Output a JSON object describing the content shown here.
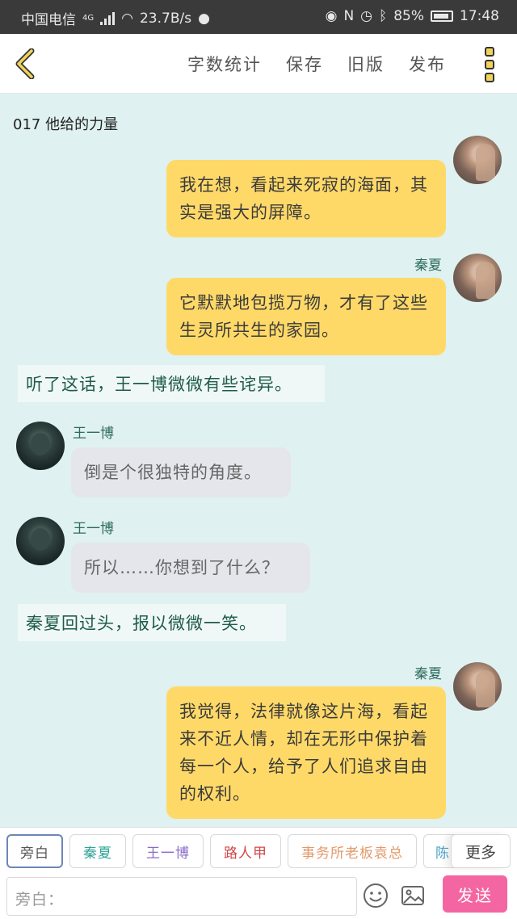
{
  "status_bar": {
    "carrier": "中国电信",
    "network": "4G",
    "speed": "23.7B/s",
    "battery": "85%",
    "time": "17:48"
  },
  "toolbar": {
    "word_count": "字数统计",
    "save": "保存",
    "old_version": "旧版",
    "publish": "发布"
  },
  "chapter": {
    "title": "017 他给的力量"
  },
  "messages": [
    {
      "type": "right",
      "speaker": "秦夏",
      "text": "我在想，看起来死寂的海面，其实是强大的屏障。"
    },
    {
      "type": "right",
      "speaker": "秦夏",
      "text": "它默默地包揽万物，才有了这些生灵所共生的家园。"
    },
    {
      "type": "narration",
      "text": "听了这话，王一博微微有些诧异。"
    },
    {
      "type": "left",
      "speaker": "王一博",
      "text": "倒是个很独特的角度。"
    },
    {
      "type": "left",
      "speaker": "王一博",
      "text": "所以……你想到了什么？"
    },
    {
      "type": "narration",
      "text": "秦夏回过头，报以微微一笑。"
    },
    {
      "type": "right",
      "speaker": "秦夏",
      "text": "我觉得，法律就像这片海，看起来不近人情，却在无形中保护着每一个人，给予了人们追求自由的权利。"
    }
  ],
  "roles": [
    {
      "label": "旁白",
      "color": "#555555"
    },
    {
      "label": "秦夏",
      "color": "#2fa39a"
    },
    {
      "label": "王一博",
      "color": "#8a6cc8"
    },
    {
      "label": "路人甲",
      "color": "#d04747"
    },
    {
      "label": "事务所老板袁总",
      "color": "#e29a6a"
    },
    {
      "label": "陈",
      "color": "#4aa3c9"
    }
  ],
  "more_label": "更多",
  "composer": {
    "placeholder": "旁白：",
    "send_label": "发送",
    "emoji_icon": "smiley-icon",
    "image_icon": "image-icon"
  },
  "colors": {
    "background": "#dff1f0",
    "right_bubble": "#ffd968",
    "left_bubble": "#e5e6ec",
    "send_button": "#f466a1"
  }
}
